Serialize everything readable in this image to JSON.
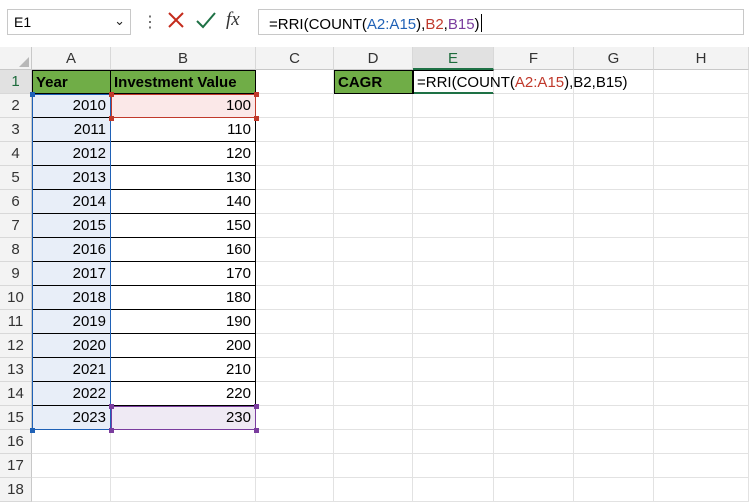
{
  "formula_bar": {
    "name_box": "E1",
    "dropdown_glyph": "⌄",
    "dots": "⋮",
    "fx": "fx",
    "formula_parts": [
      {
        "text": "=RRI(COUNT(",
        "cls": ""
      },
      {
        "text": "A2:A15",
        "cls": "ref-blue"
      },
      {
        "text": "),",
        "cls": ""
      },
      {
        "text": "B2",
        "cls": "ref-red"
      },
      {
        "text": ",",
        "cls": ""
      },
      {
        "text": "B15",
        "cls": "ref-purple"
      },
      {
        "text": ")",
        "cls": ""
      }
    ]
  },
  "columns": [
    "A",
    "B",
    "C",
    "D",
    "E",
    "F",
    "G",
    "H"
  ],
  "selected_column": "E",
  "rows": [
    "1",
    "2",
    "3",
    "4",
    "5",
    "6",
    "7",
    "8",
    "9",
    "10",
    "11",
    "12",
    "13",
    "14",
    "15",
    "16",
    "17",
    "18"
  ],
  "selected_row": "1",
  "headers": {
    "year": "Year",
    "investment": "Investment Value",
    "cagr": "CAGR"
  },
  "years": [
    "2010",
    "2011",
    "2012",
    "2013",
    "2014",
    "2015",
    "2016",
    "2017",
    "2018",
    "2019",
    "2020",
    "2021",
    "2022",
    "2023"
  ],
  "values": [
    "100",
    "110",
    "120",
    "130",
    "140",
    "150",
    "160",
    "170",
    "180",
    "190",
    "200",
    "210",
    "220",
    "230"
  ],
  "edit_cell": {
    "parts": [
      {
        "text": "=RRI(COUNT(",
        "cls": ""
      },
      {
        "text": "A2:A15",
        "cls": "ref-red"
      },
      {
        "text": "),B2,B15)",
        "cls": ""
      }
    ]
  },
  "colors": {
    "header_fill": "#70ad47",
    "range_blue": "#1f61b6",
    "range_red": "#c0392b",
    "range_purple": "#7a3d9e",
    "selection_green": "#1e7145"
  }
}
